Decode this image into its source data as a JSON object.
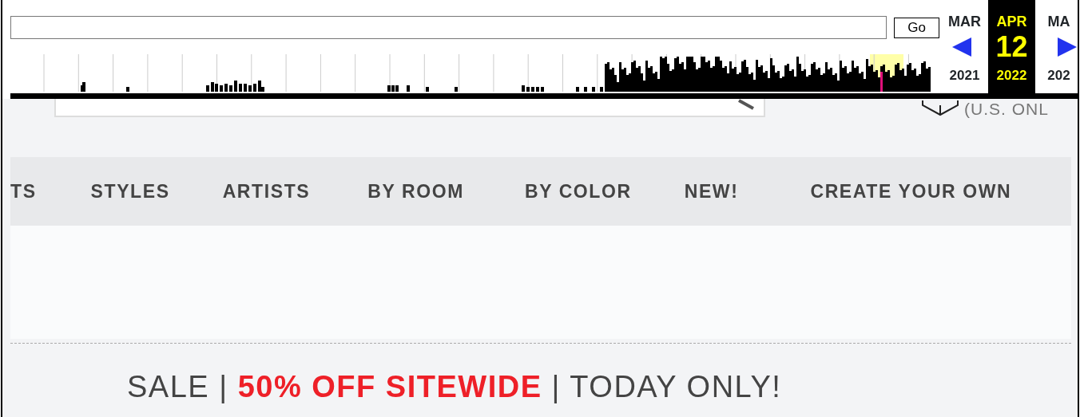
{
  "toolbar": {
    "go_button": "Go",
    "calendar": [
      {
        "month": "MAR",
        "year": "2021",
        "selected": false
      },
      {
        "month": "APR",
        "day": "12",
        "year": "2022",
        "selected": true
      },
      {
        "month": "MA",
        "year": "202",
        "selected": false
      }
    ]
  },
  "site": {
    "shipping_text": "(U.S. ONL",
    "nav_items": [
      "TS",
      "STYLES",
      "ARTISTS",
      "BY ROOM",
      "BY COLOR",
      "NEW!",
      "CREATE YOUR OWN"
    ],
    "sale_banner": [
      {
        "text": "SALE |",
        "kind": "plain"
      },
      {
        "text": "50% OFF SITEWIDE",
        "kind": "highlight"
      },
      {
        "text": "| TODAY ONLY!",
        "kind": "plain"
      }
    ]
  }
}
